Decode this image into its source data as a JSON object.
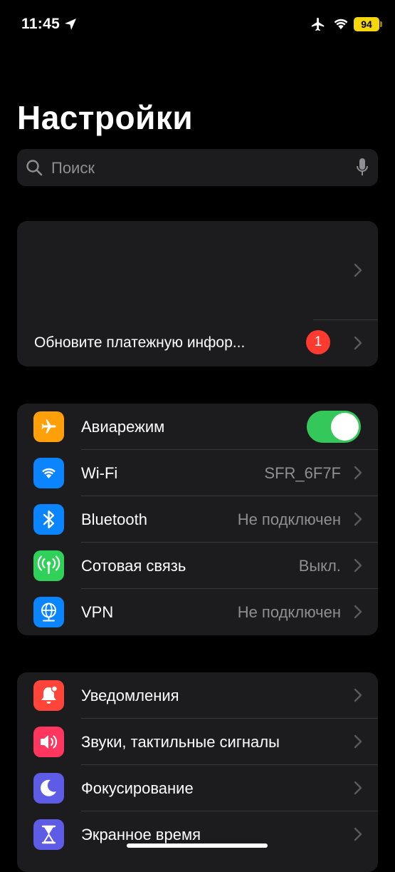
{
  "status_bar": {
    "time": "11:45",
    "battery": "94",
    "icons": [
      "location-arrow-icon",
      "airplane-icon",
      "wifi-icon",
      "battery-icon"
    ]
  },
  "header": {
    "title": "Настройки"
  },
  "search": {
    "placeholder": "Поиск"
  },
  "account": {
    "update_label": "Обновите платежную инфор...",
    "badge": "1"
  },
  "network": {
    "items": [
      {
        "label": "Авиарежим",
        "value": "",
        "icon": "airplane-icon",
        "color": "#ff9f0a",
        "toggle": true
      },
      {
        "label": "Wi-Fi",
        "value": "SFR_6F7F",
        "icon": "wifi-icon",
        "color": "#0a84ff"
      },
      {
        "label": "Bluetooth",
        "value": "Не подключен",
        "icon": "bluetooth-icon",
        "color": "#0a84ff"
      },
      {
        "label": "Сотовая связь",
        "value": "Выкл.",
        "icon": "antenna-icon",
        "color": "#30d158"
      },
      {
        "label": "VPN",
        "value": "Не подключен",
        "icon": "globe-icon",
        "color": "#0a84ff"
      }
    ]
  },
  "notifications": {
    "items": [
      {
        "label": "Уведомления",
        "icon": "bell-icon",
        "color": "#ff453a"
      },
      {
        "label": "Звуки, тактильные сигналы",
        "icon": "speaker-icon",
        "color": "#ff375f"
      },
      {
        "label": "Фокусирование",
        "icon": "moon-icon",
        "color": "#5e5ce6"
      },
      {
        "label": "Экранное время",
        "icon": "hourglass-icon",
        "color": "#5e5ce6"
      }
    ]
  },
  "colors": {
    "accent_toggle": "#34c759",
    "badge": "#ff3b30",
    "cell": "#1c1c1e",
    "secondary_text": "#8e8e93"
  }
}
